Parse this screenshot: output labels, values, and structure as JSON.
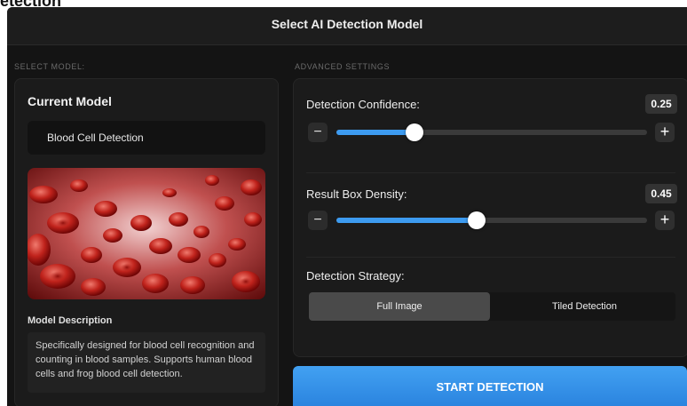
{
  "page_heading_fragment": "etection",
  "window": {
    "title": "Select AI Detection Model"
  },
  "left": {
    "section_label": "SELECT MODEL:",
    "current_model_title": "Current Model",
    "selected_model": "Blood Cell Detection",
    "description_title": "Model Description",
    "description": "Specifically designed for blood cell recognition and counting in blood samples. Supports human blood cells and frog blood cell detection."
  },
  "right": {
    "section_label": "ADVANCED SETTINGS",
    "confidence": {
      "label": "Detection Confidence:",
      "value": "0.25",
      "fraction": 0.25
    },
    "density": {
      "label": "Result Box Density:",
      "value": "0.45",
      "fraction": 0.45
    },
    "strategy": {
      "label": "Detection Strategy:",
      "options": [
        "Full Image",
        "Tiled Detection"
      ],
      "selected": "Full Image"
    },
    "minus_symbol": "−",
    "plus_symbol": "+"
  },
  "start_button": "START DETECTION",
  "colors": {
    "accent": "#3d9bf0",
    "button": "#2b84df",
    "background": "#141414",
    "panel": "#1b1b1b"
  }
}
